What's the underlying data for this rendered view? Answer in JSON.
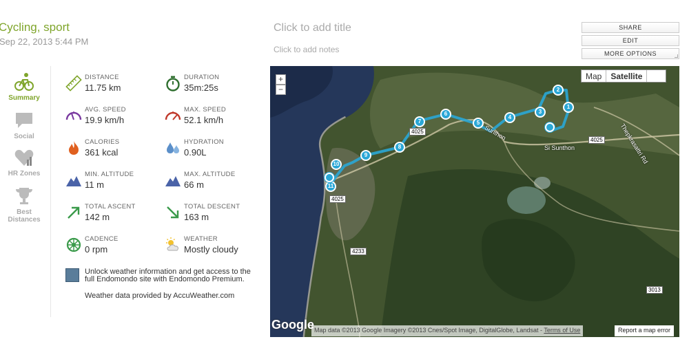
{
  "header": {
    "activity_title": "Cycling, sport",
    "activity_date": "Sep 22, 2013 5:44 PM",
    "title_placeholder": "Click to add title",
    "notes_placeholder": "Click to add notes"
  },
  "actions": {
    "share": "SHARE",
    "edit": "EDIT",
    "more": "MORE OPTIONS"
  },
  "nav": {
    "summary": "Summary",
    "social": "Social",
    "hr_zones": "HR Zones",
    "best_distances": "Best Distances"
  },
  "stats": {
    "distance": {
      "label": "DISTANCE",
      "value": "11.75 km",
      "icon": "ruler-icon"
    },
    "duration": {
      "label": "DURATION",
      "value": "35m:25s",
      "icon": "stopwatch-icon"
    },
    "avg_speed": {
      "label": "AVG. SPEED",
      "value": "19.9 km/h",
      "icon": "gauge-icon"
    },
    "max_speed": {
      "label": "MAX. SPEED",
      "value": "52.1 km/h",
      "icon": "speedometer-icon"
    },
    "calories": {
      "label": "CALORIES",
      "value": "361 kcal",
      "icon": "flame-icon"
    },
    "hydration": {
      "label": "HYDRATION",
      "value": "0.90L",
      "icon": "water-drop-icon"
    },
    "min_altitude": {
      "label": "MIN. ALTITUDE",
      "value": "11 m",
      "icon": "mountain-icon"
    },
    "max_altitude": {
      "label": "MAX. ALTITUDE",
      "value": "66 m",
      "icon": "mountain-icon"
    },
    "total_ascent": {
      "label": "TOTAL ASCENT",
      "value": "142 m",
      "icon": "arrow-up-right-icon"
    },
    "total_descent": {
      "label": "TOTAL DESCENT",
      "value": "163 m",
      "icon": "arrow-down-right-icon"
    },
    "cadence": {
      "label": "CADENCE",
      "value": "0 rpm",
      "icon": "gear-wheel-icon"
    },
    "weather": {
      "label": "WEATHER",
      "value": "Mostly cloudy",
      "icon": "cloudy-sun-icon"
    }
  },
  "premium": {
    "text": "Unlock weather information and get access to the full Endomondo site with Endomondo Premium.",
    "credit": "Weather data provided by AccuWeather.com"
  },
  "map": {
    "zoom_in": "+",
    "zoom_out": "−",
    "type_map": "Map",
    "type_satellite": "Satellite",
    "logo": "Google",
    "attribution": "Map data ©2013 Google Imagery ©2013 Cnes/Spot Image, DigitalGlobe, Landsat -",
    "terms": "Terms of Use",
    "report": "Report a map error",
    "road_labels": [
      "Si Sunthon",
      "Sunthon",
      "Thepkrasattri Rd",
      "4025",
      "4025",
      "4025",
      "4233",
      "3013"
    ],
    "route_markers": [
      "1",
      "2",
      "3",
      "4",
      "5",
      "6",
      "7",
      "8",
      "9",
      "10",
      "11"
    ]
  },
  "colors": {
    "accent": "#7fa52b",
    "route": "#2aa7d6"
  }
}
